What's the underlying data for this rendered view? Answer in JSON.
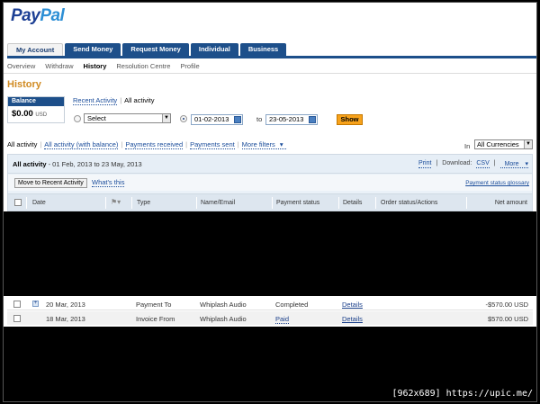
{
  "brand": {
    "logo_part1": "Pay",
    "logo_part2": "Pal"
  },
  "tabs": [
    {
      "label": "My Account",
      "active": true
    },
    {
      "label": "Send Money",
      "active": false
    },
    {
      "label": "Request Money",
      "active": false
    },
    {
      "label": "Individual",
      "active": false
    },
    {
      "label": "Business",
      "active": false
    }
  ],
  "subnav": [
    {
      "label": "Overview",
      "active": false
    },
    {
      "label": "Withdraw",
      "active": false
    },
    {
      "label": "History",
      "active": true
    },
    {
      "label": "Resolution Centre",
      "active": false
    },
    {
      "label": "Profile",
      "active": false
    }
  ],
  "page_title": "History",
  "balance": {
    "label": "Balance",
    "amount": "$0.00",
    "currency": "USD"
  },
  "view_modes": {
    "recent": "Recent Activity",
    "separator": "|",
    "all": "All activity"
  },
  "search": {
    "select_value": "Select",
    "date_from": "01-02-2013",
    "to_label": "to",
    "date_to": "23-05-2013",
    "show_label": "Show"
  },
  "filters": {
    "items": [
      "All activity",
      "All activity (with balance)",
      "Payments received",
      "Payments sent",
      "More filters"
    ],
    "separator": "|",
    "in_label": "In",
    "currency_value": "All Currencies"
  },
  "panel": {
    "title": "All activity",
    "range": " - 01 Feb, 2013 to 23 May, 2013",
    "print": "Print",
    "download_label": "Download:",
    "csv": "CSV",
    "more": "More",
    "move_button": "Move to Recent Activity",
    "whats_this": "What's this",
    "glossary": "Payment status glossary"
  },
  "table": {
    "columns": [
      "Date",
      "Type",
      "Name/Email",
      "Payment status",
      "Details",
      "Order status/Actions",
      "Net amount"
    ],
    "rows": [
      {
        "date": "20 Mar, 2013",
        "type": "Payment To",
        "name": "Whiplash Audio",
        "status": "Completed",
        "details": "Details",
        "net": "-$570.00 USD"
      },
      {
        "date": "18 Mar, 2013",
        "type": "Invoice From",
        "name": "Whiplash Audio",
        "status": "Paid",
        "details": "Details",
        "net": "$570.00 USD"
      }
    ]
  },
  "watermark": "[962x689] https://upic.me/"
}
